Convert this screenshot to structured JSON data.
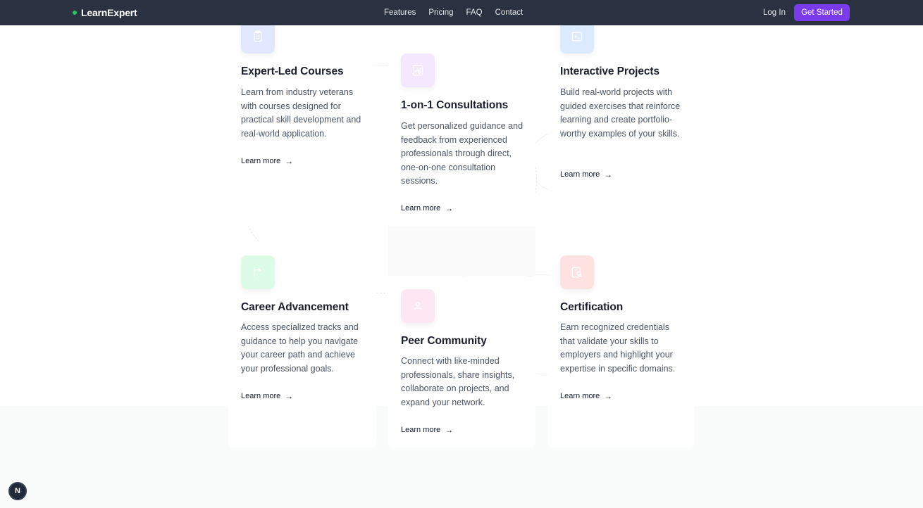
{
  "nav": {
    "brand": "LearnExpert",
    "links": [
      "Features",
      "Pricing",
      "FAQ",
      "Contact"
    ],
    "login": "Log In",
    "cta": "Get Started"
  },
  "features": [
    {
      "title": "Expert-Led Courses",
      "description": "Learn from industry veterans with courses designed for practical skill development and real-world application.",
      "link": "Learn more",
      "icon": "clipboard-icon",
      "accent": "#e0e7ff"
    },
    {
      "title": "1-on-1 Consultations",
      "description": "Get personalized guidance and feedback from experienced professionals through direct, one-on-one consultation sessions.",
      "link": "Learn more",
      "icon": "chart-board-icon",
      "accent": "#f3e8ff"
    },
    {
      "title": "Interactive Projects",
      "description": "Build real-world projects with guided exercises that reinforce learning and create portfolio-worthy examples of your skills.",
      "link": "Learn more",
      "icon": "terminal-icon",
      "accent": "#dbeafe"
    },
    {
      "title": "Career Advancement",
      "description": "Access specialized tracks and guidance to help you navigate your career path and achieve your professional goals.",
      "link": "Learn more",
      "icon": "flag-arrow-icon",
      "accent": "#dcfce7"
    },
    {
      "title": "Peer Community",
      "description": "Connect with like-minded professionals, share insights, collaborate on projects, and expand your network.",
      "link": "Learn more",
      "icon": "user-icon",
      "accent": "#fce7f3"
    },
    {
      "title": "Certification",
      "description": "Earn recognized credentials that validate your skills to employers and highlight your expertise in specific domains.",
      "link": "Learn more",
      "icon": "certificate-icon",
      "accent": "#fee2e2"
    }
  ],
  "corner_badge": "N"
}
